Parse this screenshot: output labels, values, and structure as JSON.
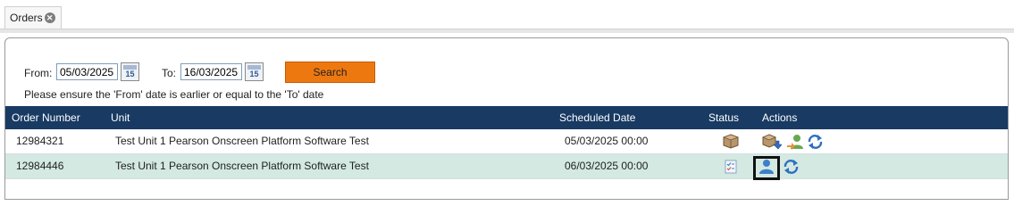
{
  "tab": {
    "label": "Orders"
  },
  "filters": {
    "from_label": "From:",
    "from_value": "05/03/2025",
    "to_label": "To:",
    "to_value": "16/03/2025",
    "calendar_day": "15",
    "search_label": "Search",
    "hint": "Please ensure the 'From' date is earlier or equal to the 'To' date"
  },
  "grid": {
    "columns": [
      "Order Number",
      "Unit",
      "Scheduled Date",
      "Status",
      "Actions"
    ],
    "rows": [
      {
        "order_number": "12984321",
        "unit": "Test Unit 1 Pearson Onscreen Platform Software Test",
        "scheduled_date": "05/03/2025 00:00",
        "status_icon": "package-icon",
        "actions": [
          "package-download-icon",
          "assign-user-icon",
          "refresh-icon"
        ]
      },
      {
        "order_number": "12984446",
        "unit": "Test Unit 1 Pearson Onscreen Platform Software Test",
        "scheduled_date": "06/03/2025 00:00",
        "status_icon": "checklist-icon",
        "actions": [
          "assign-user-icon",
          "refresh-icon"
        ]
      }
    ]
  },
  "colors": {
    "header_bg": "#183a63",
    "search_button": "#ee7810",
    "alt_row": "#d3e9e1"
  }
}
